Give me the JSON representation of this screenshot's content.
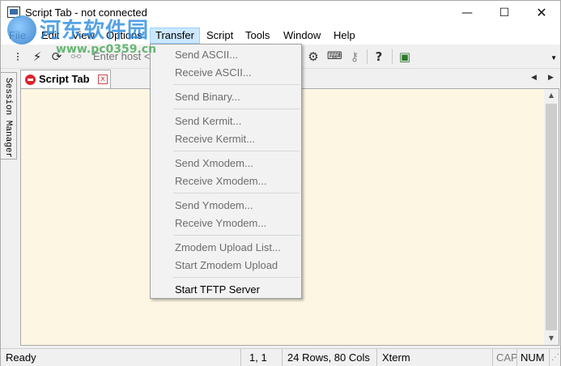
{
  "window": {
    "title": "Script Tab - not connected",
    "min_glyph": "—",
    "max_glyph": "☐",
    "close_glyph": "✕"
  },
  "watermark": {
    "site_name": "河东软件园",
    "url": "www.pc0359.cn"
  },
  "menubar": [
    "File",
    "Edit",
    "View",
    "Options",
    "Transfer",
    "Script",
    "Tools",
    "Window",
    "Help"
  ],
  "toolbar": {
    "host_placeholder": "Enter host <"
  },
  "session_manager": {
    "label": "Session Manager"
  },
  "tab": {
    "label": "Script Tab",
    "close_glyph": "x",
    "nav_left": "◀",
    "nav_right": "▶"
  },
  "transfer_menu": [
    {
      "label": "Send ASCII...",
      "enabled": false
    },
    {
      "label": "Receive ASCII...",
      "enabled": false
    },
    {
      "label": "Send Binary...",
      "enabled": false
    },
    {
      "label": "Send Kermit...",
      "enabled": false
    },
    {
      "label": "Receive Kermit...",
      "enabled": false
    },
    {
      "label": "Send Xmodem...",
      "enabled": false
    },
    {
      "label": "Receive Xmodem...",
      "enabled": false
    },
    {
      "label": "Send Ymodem...",
      "enabled": false
    },
    {
      "label": "Receive Ymodem...",
      "enabled": false
    },
    {
      "label": "Zmodem Upload List...",
      "enabled": false
    },
    {
      "label": "Start Zmodem Upload",
      "enabled": false
    },
    {
      "label": "Start TFTP Server",
      "enabled": true
    }
  ],
  "statusbar": {
    "status": "Ready",
    "cursor": "1,   1",
    "size": "24 Rows, 80 Cols",
    "terminal": "Xterm",
    "cap": "CAP",
    "num": "NUM"
  },
  "colors": {
    "terminal_bg": "#fdf6e3",
    "menu_highlight": "#cce8ff"
  }
}
